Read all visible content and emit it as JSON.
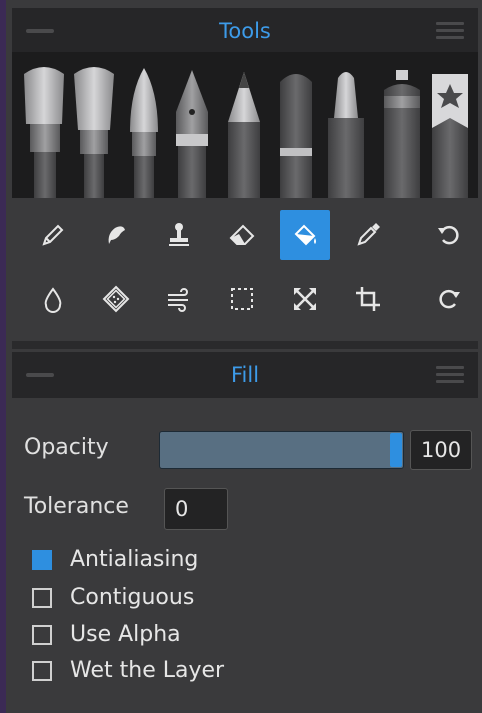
{
  "tools_panel": {
    "title": "Tools"
  },
  "fill_panel": {
    "title": "Fill",
    "opacity_label": "Opacity",
    "opacity_value": "100",
    "opacity_fraction": 1.0,
    "tolerance_label": "Tolerance",
    "tolerance_value": "0",
    "options": [
      {
        "label": "Antialiasing",
        "checked": true
      },
      {
        "label": "Contiguous",
        "checked": false
      },
      {
        "label": "Use Alpha",
        "checked": false
      },
      {
        "label": "Wet the Layer",
        "checked": false
      }
    ]
  },
  "brushes": [
    "oil-brush-icon",
    "wide-brush-icon",
    "round-brush-icon",
    "ink-pen-icon",
    "pencil-icon",
    "pastel-icon",
    "marker-icon",
    "airbrush-icon",
    "favorite-brush-icon"
  ],
  "tool_row_1": [
    "pencil-tool-icon",
    "smudge-tool-icon",
    "stamp-tool-icon",
    "eraser-tool-icon",
    "fill-tool-icon",
    "eyedropper-tool-icon",
    "undo-icon"
  ],
  "tool_row_2": [
    "blur-tool-icon",
    "texture-tool-icon",
    "wind-tool-icon",
    "selection-tool-icon",
    "transform-tool-icon",
    "crop-tool-icon",
    "redo-icon"
  ],
  "colors": {
    "accent": "#2e8fe0",
    "title": "#3d9be9",
    "panel_bg": "#3a3a3c",
    "header_bg": "#262628"
  }
}
